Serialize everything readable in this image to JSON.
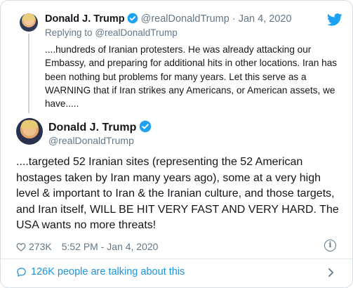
{
  "parent": {
    "name": "Donald J. Trump",
    "handle": "@realDonaldTrump",
    "separator": "·",
    "date": "Jan 4, 2020",
    "replying_prefix": "Replying to",
    "replying_to": "@realDonaldTrump",
    "text": "....hundreds of Iranian protesters. He was already attacking our Embassy, and preparing for additional hits in other locations. Iran has been nothing but problems for many years. Let this serve as a WARNING that if Iran strikes any Americans, or American assets, we have....."
  },
  "main": {
    "name": "Donald J. Trump",
    "handle": "@realDonaldTrump",
    "text": "....targeted 52 Iranian sites (representing the 52 American hostages taken by Iran many years ago), some at a very high level & important to Iran &  the Iranian culture, and those targets, and Iran itself, WILL BE HIT VERY FAST AND VERY HARD. The USA wants no more threats!"
  },
  "meta": {
    "likes": "273K",
    "time_date": "5:52 PM - Jan 4, 2020"
  },
  "footer": {
    "talking": "126K people are talking about this"
  },
  "icons": {
    "brand": "twitter-bird-icon",
    "verified": "verified-badge-icon",
    "like": "heart-icon",
    "info": "info-icon",
    "talk": "speech-bubble-icon",
    "chevron": "chevron-right-icon"
  },
  "colors": {
    "twitter_blue": "#1da1f2",
    "link_blue": "#1b95e0",
    "secondary_text": "#657786",
    "primary_text": "#14171a",
    "border": "#d8dee3"
  }
}
